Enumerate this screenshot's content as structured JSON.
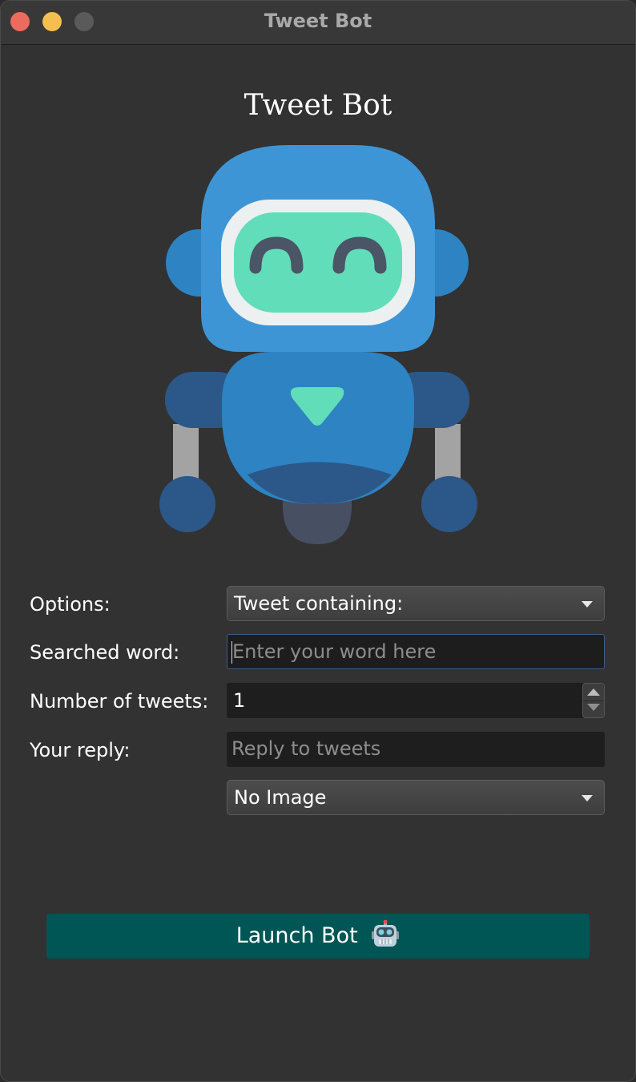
{
  "window": {
    "title": "Tweet Bot"
  },
  "header": {
    "title": "Tweet Bot",
    "illustration": "robot-icon"
  },
  "form": {
    "options": {
      "label": "Options:",
      "selected": "Tweet containing:"
    },
    "searched_word": {
      "label": "Searched word:",
      "placeholder": "Enter your word here",
      "value": ""
    },
    "number_of_tweets": {
      "label": "Number of tweets:",
      "value": "1"
    },
    "your_reply": {
      "label": "Your reply:",
      "placeholder": "Reply to tweets",
      "value": ""
    },
    "image": {
      "selected": "No Image"
    }
  },
  "launch": {
    "label": "Launch Bot",
    "icon": "robot-emoji-icon"
  },
  "colors": {
    "launch_button": "#005555",
    "robot_blue": "#3e95d5",
    "robot_visor": "#62ddb9",
    "close": "#ed6a5e",
    "minimize": "#f5bf4f"
  }
}
